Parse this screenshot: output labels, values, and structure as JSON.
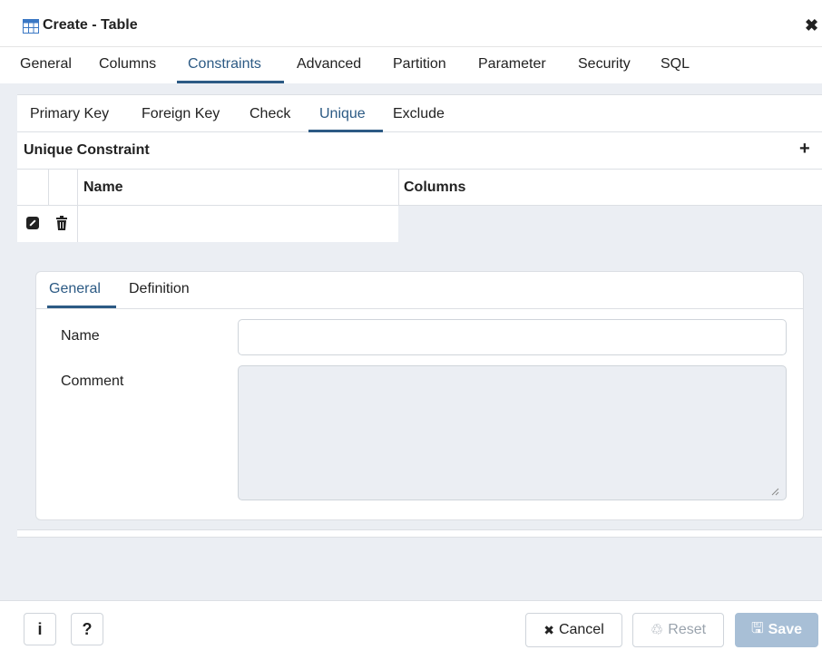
{
  "dialog": {
    "title": "Create - Table",
    "close_symbol": "✖",
    "icon": "table-icon"
  },
  "main_tabs": [
    {
      "label": "General"
    },
    {
      "label": "Columns"
    },
    {
      "label": "Constraints",
      "active": true
    },
    {
      "label": "Advanced"
    },
    {
      "label": "Partition"
    },
    {
      "label": "Parameter"
    },
    {
      "label": "Security"
    },
    {
      "label": "SQL"
    }
  ],
  "sub_tabs": [
    {
      "label": "Primary Key"
    },
    {
      "label": "Foreign Key"
    },
    {
      "label": "Check"
    },
    {
      "label": "Unique",
      "active": true
    },
    {
      "label": "Exclude"
    }
  ],
  "unique_constraint": {
    "title": "Unique Constraint",
    "add_symbol": "+",
    "columns": {
      "name": "Name",
      "columns": "Columns"
    },
    "row": {
      "name": "",
      "columns": "",
      "edit_icon": "edit-icon",
      "delete_icon": "trash-icon"
    }
  },
  "detail": {
    "tabs": [
      {
        "label": "General",
        "active": true
      },
      {
        "label": "Definition"
      }
    ],
    "name_label": "Name",
    "name_value": "",
    "comment_label": "Comment",
    "comment_value": ""
  },
  "footer": {
    "info_label": "i",
    "help_label": "?",
    "cancel_label": "Cancel",
    "cancel_icon": "✖",
    "reset_label": "Reset",
    "reset_icon": "♲",
    "save_label": "Save",
    "save_icon": "🖫"
  },
  "colors": {
    "accent": "#2c5a84",
    "panel_bg": "#ebeef3",
    "save_disabled": "#a8bfd6"
  }
}
